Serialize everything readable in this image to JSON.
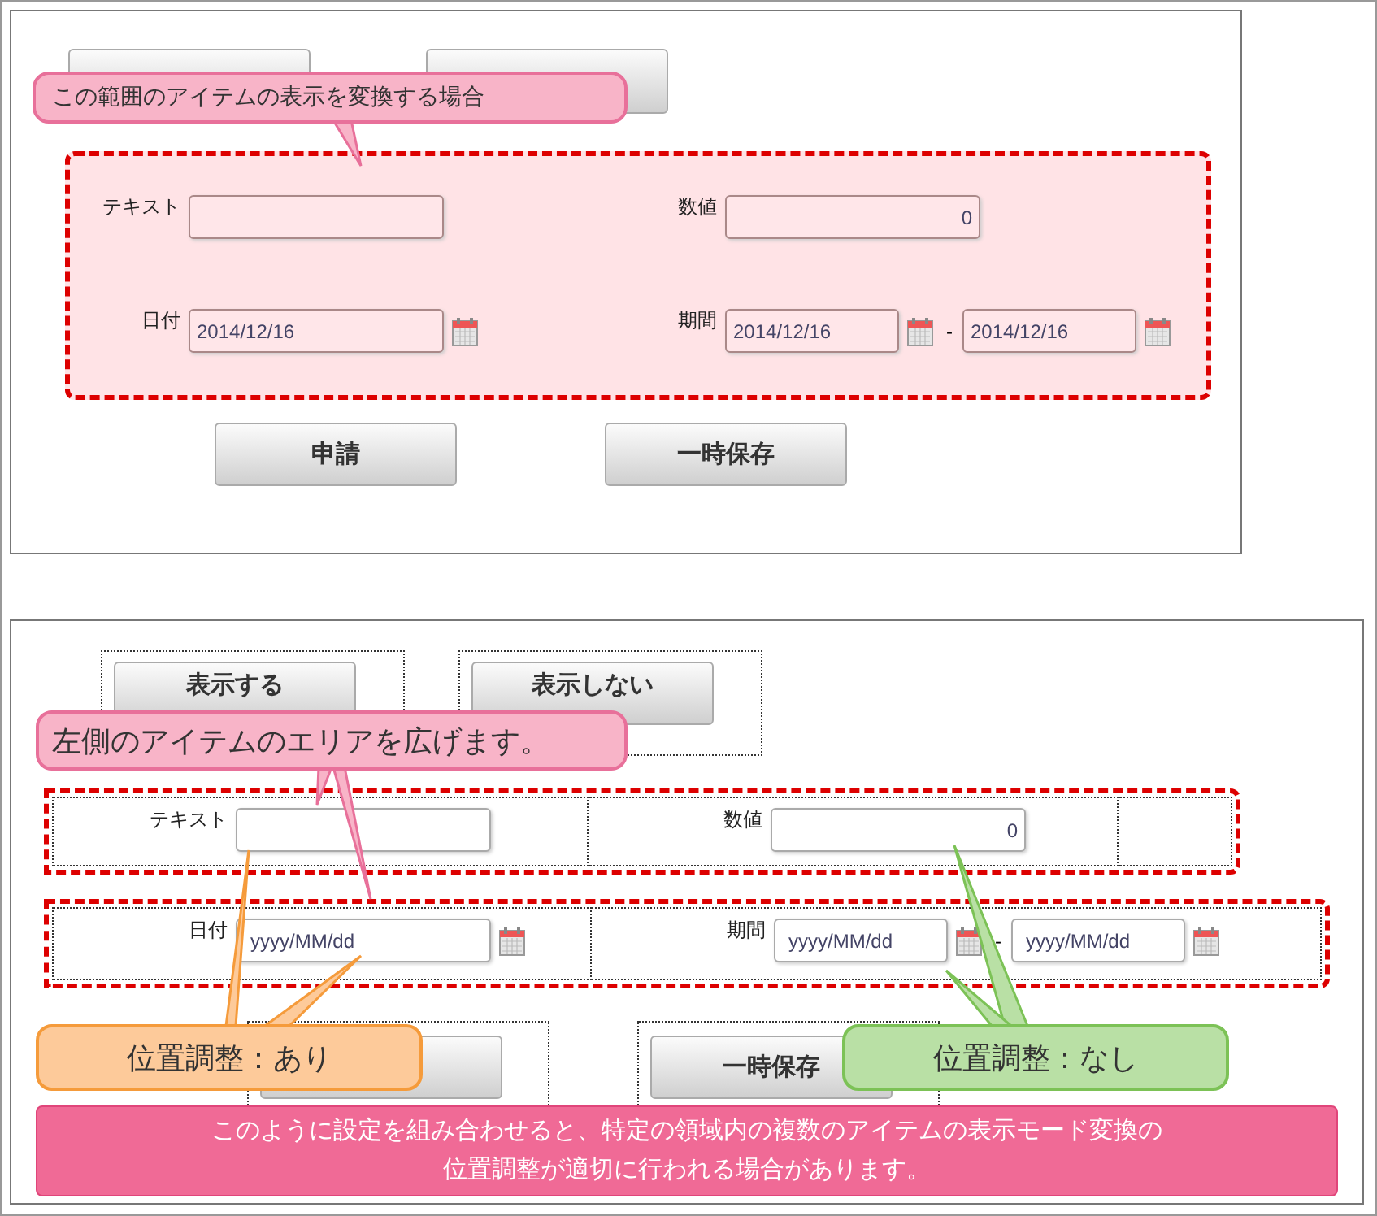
{
  "before": {
    "top_buttons": [
      {
        "kind": "hidden"
      },
      {
        "kind": "hidden"
      }
    ],
    "callout": "この範囲のアイテムの表示を変換する場合",
    "fields": [
      {
        "kind": "text",
        "label": "テキスト"
      },
      {
        "kind": "number",
        "label": "数値",
        "value": "0"
      },
      {
        "kind": "date",
        "label": "日付",
        "value": "2014/12/16"
      },
      {
        "kind": "period",
        "label": "期間",
        "from": {
          "value": "2014/12/16"
        },
        "separator": "-",
        "to": {
          "value": "2014/12/16"
        }
      }
    ],
    "buttons": [
      {
        "kind": "labeled",
        "label": "申請"
      },
      {
        "kind": "labeled",
        "label": "一時保存"
      }
    ]
  },
  "after": {
    "top_buttons": [
      {
        "kind": "labeled",
        "label": "表示する"
      },
      {
        "kind": "labeled",
        "label": "表示しない"
      }
    ],
    "callout": "左側のアイテムのエリアを広げます。",
    "fields": [
      {
        "kind": "text",
        "label": "テキスト"
      },
      {
        "kind": "number",
        "label": "数値",
        "value": "0"
      },
      {
        "kind": "date",
        "label": "日付",
        "placeholder": "yyyy/MM/dd"
      },
      {
        "kind": "period",
        "label": "期間",
        "from": {
          "placeholder": "yyyy/MM/dd"
        },
        "separator": "-",
        "to": {
          "placeholder": "yyyy/MM/dd"
        }
      }
    ],
    "notes": [
      {
        "kind": "adjusted",
        "text": "位置調整：あり"
      },
      {
        "kind": "fixed",
        "text": "位置調整：なし"
      }
    ],
    "buttons": [
      {
        "kind": "hidden"
      },
      {
        "kind": "labeled",
        "label": "一時保存"
      }
    ],
    "banner": [
      "このように設定を組み合わせると、特定の領域内の複数のアイテムの表示モード変換の",
      "位置調整が適切に行われる場合があります。"
    ]
  }
}
